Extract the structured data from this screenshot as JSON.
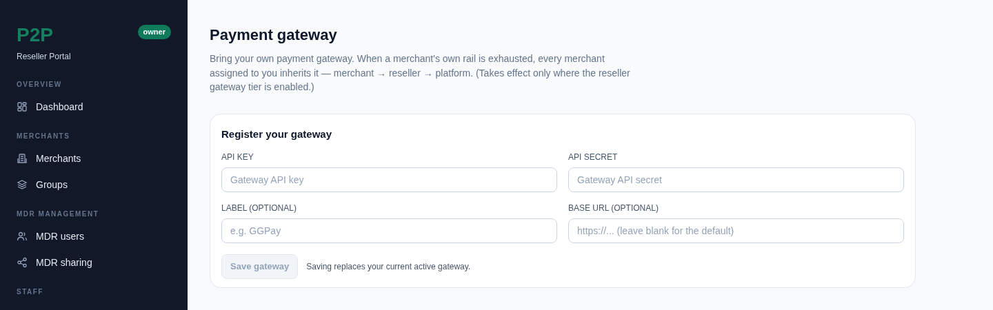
{
  "sidebar": {
    "logo": "P2P",
    "role_badge": "owner",
    "subtitle": "Reseller Portal",
    "sections": [
      {
        "heading": "OVERVIEW",
        "items": [
          {
            "label": "Dashboard"
          }
        ]
      },
      {
        "heading": "MERCHANTS",
        "items": [
          {
            "label": "Merchants"
          },
          {
            "label": "Groups"
          }
        ]
      },
      {
        "heading": "MDR MANAGEMENT",
        "items": [
          {
            "label": "MDR users"
          },
          {
            "label": "MDR sharing"
          }
        ]
      },
      {
        "heading": "STAFF"
      }
    ]
  },
  "page": {
    "title": "Payment gateway",
    "description": "Bring your own payment gateway. When a merchant's own rail is exhausted, every merchant assigned to you inherits it — merchant → reseller → platform. (Takes effect only where the reseller gateway tier is enabled.)"
  },
  "register_card": {
    "title": "Register your gateway",
    "fields": [
      {
        "label": "API KEY",
        "placeholder": "Gateway API key"
      },
      {
        "label": "API SECRET",
        "placeholder": "Gateway API secret"
      },
      {
        "label": "LABEL (OPTIONAL)",
        "placeholder": "e.g. GGPay"
      },
      {
        "label": "BASE URL (OPTIONAL)",
        "placeholder": "https://... (leave blank for the default)"
      }
    ],
    "save_button": {
      "label": "Save gateway",
      "disabled": true
    },
    "note": "Saving replaces your current active gateway."
  }
}
